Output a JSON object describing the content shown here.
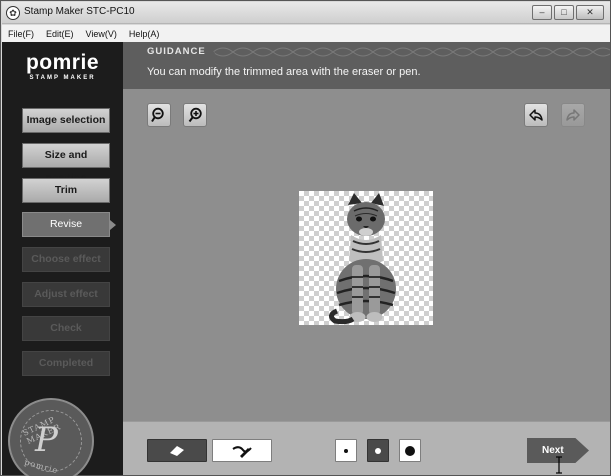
{
  "window": {
    "title": "Stamp Maker STC-PC10",
    "controls": {
      "minimize": "–",
      "maximize": "□",
      "close": "✕"
    }
  },
  "menu": [
    "File(F)",
    "Edit(E)",
    "View(V)",
    "Help(A)"
  ],
  "logo": {
    "main": "pomrie",
    "sub": "STAMP MAKER"
  },
  "steps": [
    {
      "label": "Image selection",
      "state": "done"
    },
    {
      "label": "Size and position",
      "state": "done"
    },
    {
      "label": "Trim",
      "state": "done"
    },
    {
      "label": "Revise",
      "state": "current"
    },
    {
      "label": "Choose effect",
      "state": "todo"
    },
    {
      "label": "Adjust effect",
      "state": "todo"
    },
    {
      "label": "Check",
      "state": "todo"
    },
    {
      "label": "Completed",
      "state": "todo"
    }
  ],
  "seal": {
    "top_text": "STAMP MAKER",
    "letter": "P",
    "bottom_text": "pomrie"
  },
  "guidance": {
    "label": "GUIDANCE",
    "text": "You can modify the trimmed area with the eraser or pen."
  },
  "tools": {
    "zoom_out": "zoom-out-icon",
    "zoom_in": "zoom-in-icon",
    "undo": "undo-icon",
    "redo": "redo-icon"
  },
  "bottom": {
    "eraser": "eraser-icon",
    "pen": "pen-icon",
    "sizes": [
      "small",
      "medium",
      "large"
    ],
    "active_size": "medium",
    "next_label": "Next"
  },
  "colors": {
    "sidebar": "#1c1c1c",
    "main": "#8e8e8e",
    "guidance": "#5e5e5e"
  }
}
